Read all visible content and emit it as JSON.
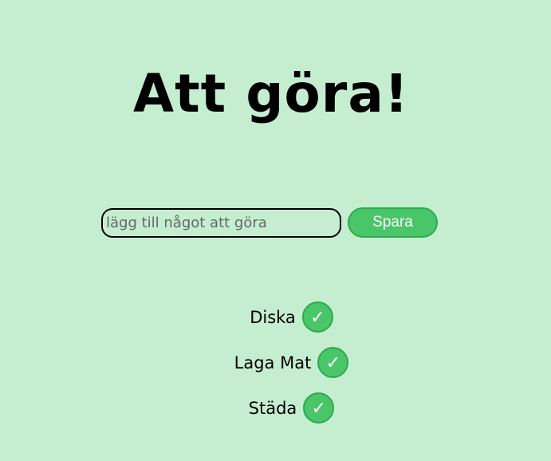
{
  "header": {
    "title": "Att göra!"
  },
  "form": {
    "placeholder": "lägg till något att göra",
    "value": "",
    "save_label": "Spara"
  },
  "todos": [
    {
      "label": "Diska",
      "check_icon": "✓"
    },
    {
      "label": "Laga Mat",
      "check_icon": "✓"
    },
    {
      "label": "Städa",
      "check_icon": "✓"
    }
  ],
  "colors": {
    "background": "#c5eed0",
    "accent": "#49c66a",
    "accent_border": "#2fa84e"
  }
}
